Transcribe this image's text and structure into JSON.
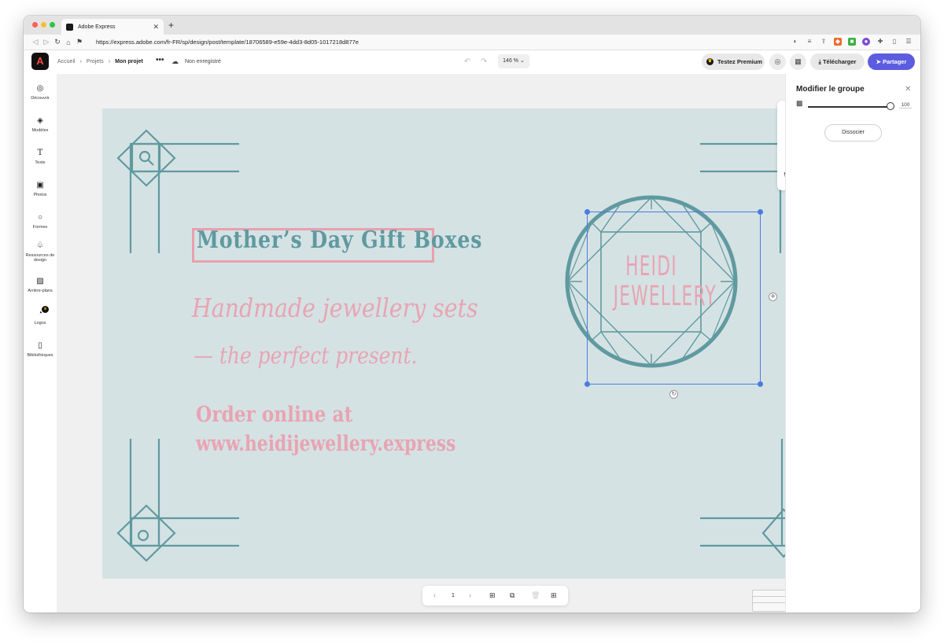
{
  "browser": {
    "tab_title": "Adobe Express",
    "new_tab": "+",
    "url": "https://express.adobe.com/fr-FR/sp/design/post/template/18706589-e59e-4dd3-8d05-1017218d877e"
  },
  "header": {
    "logo_letter": "A",
    "breadcrumbs": [
      "Accueil",
      "Projets",
      "Mon projet"
    ],
    "more": "•••",
    "save_status": "Non enregistré",
    "zoom": "146 %",
    "premium_label": "Testez Premium",
    "download_label": "Télécharger",
    "share_label": "Partager"
  },
  "sidebar": {
    "items": [
      {
        "label": "Découvrir",
        "icon": "compass-icon"
      },
      {
        "label": "Modèles",
        "icon": "templates-icon"
      },
      {
        "label": "Texte",
        "icon": "text-icon"
      },
      {
        "label": "Photos",
        "icon": "photo-icon"
      },
      {
        "label": "Formes",
        "icon": "shapes-icon"
      },
      {
        "label": "Ressources de design",
        "icon": "design-assets-icon"
      },
      {
        "label": "Arrière-plans",
        "icon": "background-icon"
      },
      {
        "label": "Logos",
        "icon": "logo-icon"
      },
      {
        "label": "Bibliothèques",
        "icon": "library-icon"
      }
    ]
  },
  "artboard": {
    "background": "#d5e2e4",
    "accent_teal": "#5f9aa0",
    "accent_pink": "#e8a4b2",
    "title": "Mother’s Day Gift Boxes",
    "script_line1": "Handmade jewellery sets",
    "script_line2": "— the perfect present.",
    "order_line1": "Order online at",
    "order_line2": "www.heidijewellery.express",
    "logo_line1": "HEIDI",
    "logo_line2": "JEWELLERY"
  },
  "pager": {
    "page": "1"
  },
  "thumbnails": {
    "count": "9"
  },
  "panel": {
    "title": "Modifier le groupe",
    "opacity_value": "100",
    "opacity_fraction": 1.0,
    "ungroup_label": "Dissocier"
  }
}
